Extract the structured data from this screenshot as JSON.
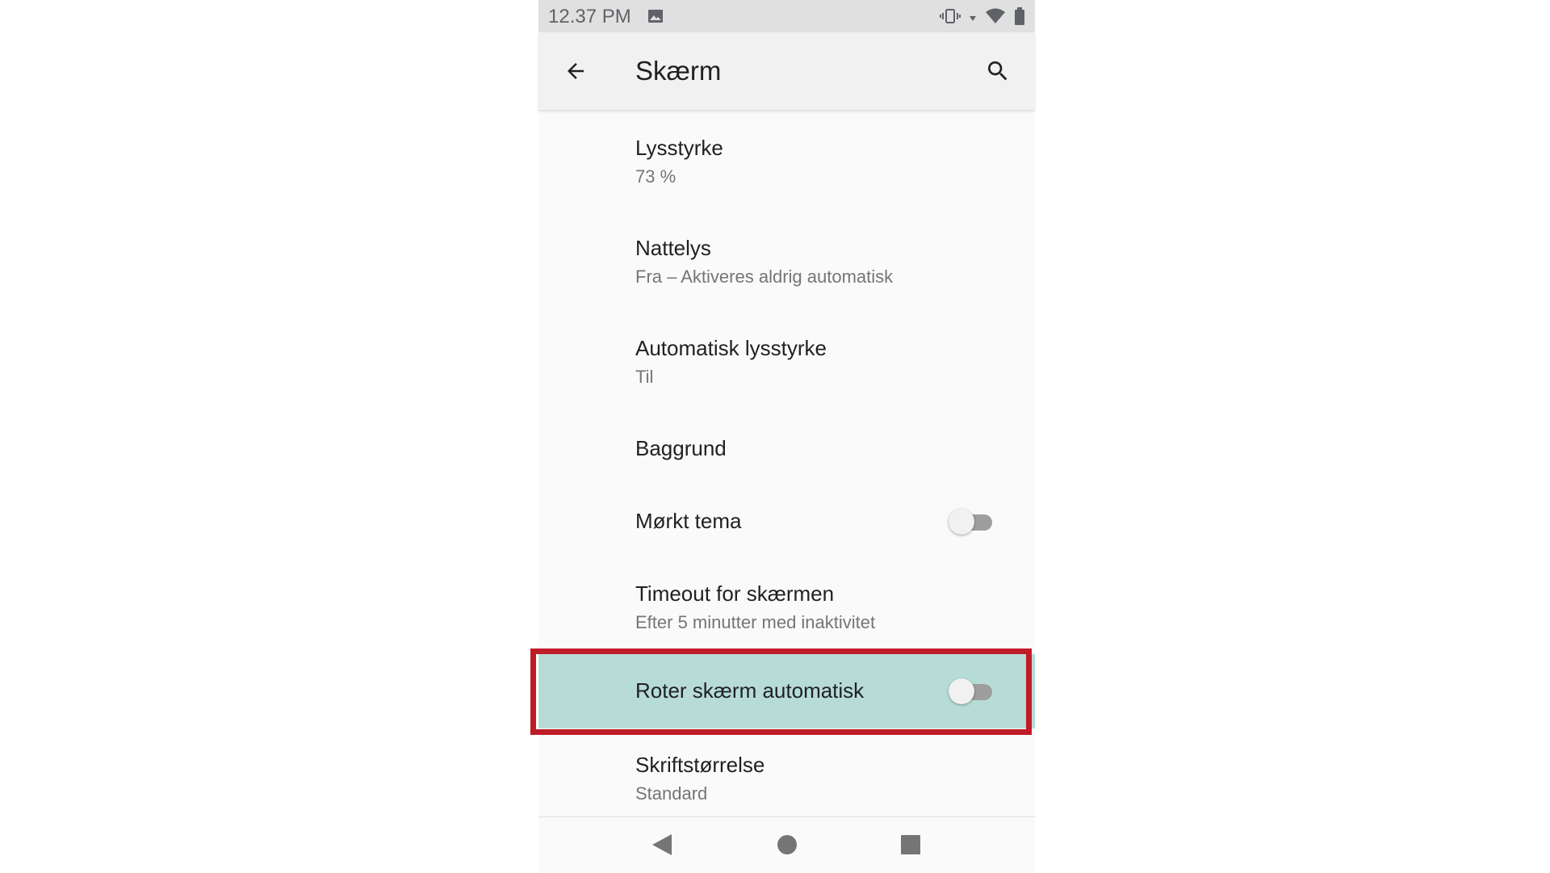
{
  "status_bar": {
    "time": "12.37 PM",
    "icons": [
      "image-icon",
      "vibrate-icon",
      "data-arrows-icon",
      "wifi-icon",
      "battery-icon"
    ]
  },
  "app_bar": {
    "title": "Skærm",
    "back_icon": "arrow-back-icon",
    "search_icon": "search-icon"
  },
  "settings": [
    {
      "title": "Lysstyrke",
      "subtitle": "73 %"
    },
    {
      "title": "Nattelys",
      "subtitle": "Fra – Aktiveres aldrig automatisk"
    },
    {
      "title": "Automatisk lysstyrke",
      "subtitle": "Til"
    },
    {
      "title": "Baggrund"
    },
    {
      "title": "Mørkt tema",
      "toggle": "off"
    },
    {
      "title": "Timeout for skærmen",
      "subtitle": "Efter 5 minutter med inaktivitet"
    },
    {
      "title": "Roter skærm automatisk",
      "toggle": "off",
      "highlighted": true
    },
    {
      "title": "Skriftstørrelse",
      "subtitle": "Standard"
    }
  ],
  "nav_bar": {
    "icons": [
      "nav-back-icon",
      "nav-home-icon",
      "nav-recents-icon"
    ]
  },
  "colors": {
    "highlight_row": "#b7dcd7",
    "highlight_border": "#c01c28",
    "toggle_track_off": "#9e9e9e"
  }
}
